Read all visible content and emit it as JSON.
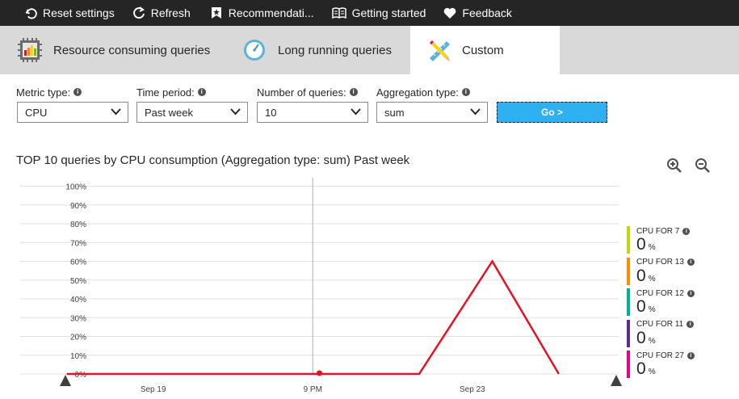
{
  "toolbar": {
    "reset": "Reset settings",
    "refresh": "Refresh",
    "recommendations": "Recommendati...",
    "getting_started": "Getting started",
    "feedback": "Feedback"
  },
  "tabs": [
    {
      "label": "Resource consuming queries"
    },
    {
      "label": "Long running queries"
    },
    {
      "label": "Custom"
    }
  ],
  "filters": {
    "metric": {
      "label": "Metric type:",
      "value": "CPU"
    },
    "period": {
      "label": "Time period:",
      "value": "Past week"
    },
    "count": {
      "label": "Number of queries:",
      "value": "10"
    },
    "aggregation": {
      "label": "Aggregation type:",
      "value": "sum"
    },
    "go": "Go >"
  },
  "chart_title": "TOP 10 queries by CPU consumption (Aggregation type: sum) Past week",
  "legend": [
    {
      "name": "CPU FOR 7",
      "value": "0",
      "unit": "%",
      "color": "#bad80a"
    },
    {
      "name": "CPU FOR 13",
      "value": "0",
      "unit": "%",
      "color": "#ff8c00"
    },
    {
      "name": "CPU FOR 12",
      "value": "0",
      "unit": "%",
      "color": "#00b294"
    },
    {
      "name": "CPU FOR 11",
      "value": "0",
      "unit": "%",
      "color": "#5c2d91"
    },
    {
      "name": "CPU FOR 27",
      "value": "0",
      "unit": "%",
      "color": "#e3008c"
    }
  ],
  "chart_data": {
    "type": "line",
    "yticks": [
      "100%",
      "90%",
      "80%",
      "70%",
      "60%",
      "50%",
      "40%",
      "30%",
      "20%",
      "10%",
      "0%"
    ],
    "ylim": [
      0,
      100
    ],
    "xlim": [
      0,
      9
    ],
    "xticks": [
      {
        "label": "Sep 19",
        "x": 2
      },
      {
        "label": "9 PM",
        "x": 4.4
      },
      {
        "label": "Sep 23",
        "x": 6.8
      }
    ],
    "series": [
      {
        "color": "#e81123",
        "points": [
          [
            0.7,
            0
          ],
          [
            6,
            0
          ],
          [
            7.1,
            60
          ],
          [
            8.1,
            0
          ]
        ]
      }
    ]
  }
}
